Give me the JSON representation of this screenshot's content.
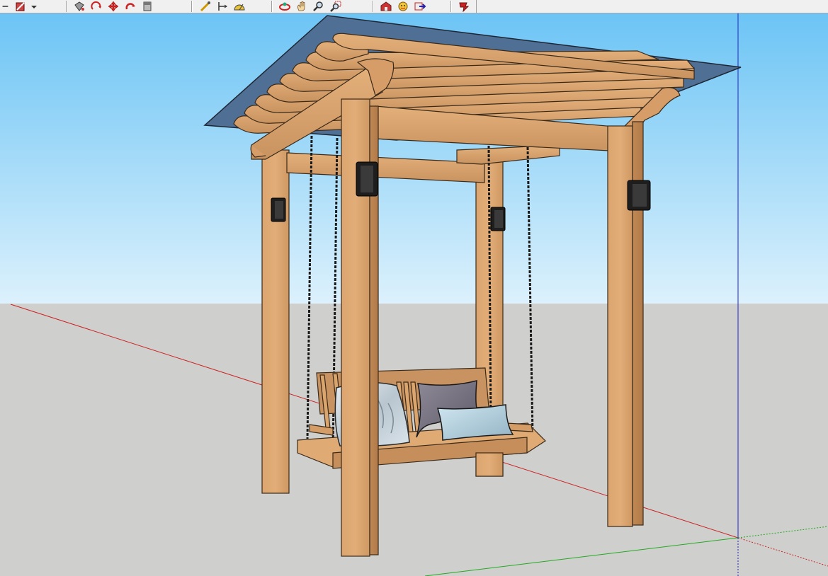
{
  "app": {
    "toolbar": {
      "groups": [
        {
          "id": "draw",
          "icons": [
            "partial-arrow-icon",
            "pencil-square-icon",
            "dropdown-arrow-icon"
          ]
        },
        {
          "id": "edit",
          "icons": [
            "paint-bucket-icon",
            "rotate-icon",
            "move-icon",
            "follow-me-icon",
            "eraser-icon"
          ]
        },
        {
          "id": "measure",
          "icons": [
            "tape-measure-icon",
            "dimension-icon",
            "protractor-icon"
          ]
        },
        {
          "id": "camera",
          "icons": [
            "orbit-icon",
            "pan-icon",
            "zoom-icon",
            "zoom-window-icon"
          ]
        },
        {
          "id": "warehouse",
          "icons": [
            "warehouse-icon",
            "components-icon",
            "share-model-icon"
          ]
        },
        {
          "id": "extension",
          "icons": [
            "extension-warehouse-icon"
          ]
        }
      ]
    },
    "colors": {
      "sky_top": "#6cc4f5",
      "sky_bottom": "#dcf1fc",
      "ground": "#cfcfcd",
      "wood": "#d8a06a",
      "wood_dark": "#b9834f",
      "roof": "#4f6f95",
      "red_axis": "#cc2222",
      "green_axis": "#22aa22",
      "blue_axis": "#2222cc"
    }
  }
}
